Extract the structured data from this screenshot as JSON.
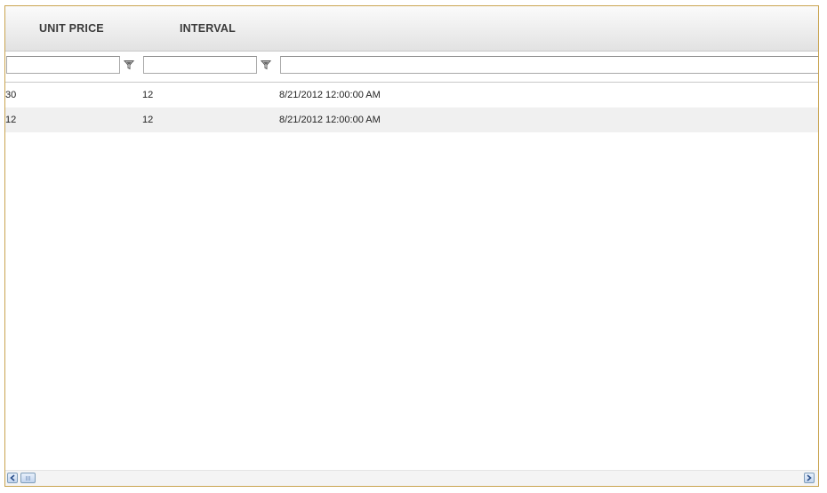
{
  "grid": {
    "columns": [
      {
        "label": "UNIT PRICE"
      },
      {
        "label": "INTERVAL"
      },
      {
        "label": ""
      }
    ],
    "filters": [
      {
        "value": "",
        "icon": "filter-icon"
      },
      {
        "value": "",
        "icon": "filter-icon"
      },
      {
        "value": ""
      }
    ],
    "rows": [
      {
        "unit_price": "30",
        "interval": "12",
        "date": "8/21/2012 12:00:00 AM"
      },
      {
        "unit_price": "12",
        "interval": "12",
        "date": "8/21/2012 12:00:00 AM"
      }
    ]
  },
  "scrollbar": {
    "left_icon": "chevron-left-icon",
    "right_icon": "chevron-right-icon"
  },
  "colors": {
    "border": "#c9a450",
    "alt_row": "#f0f0f0",
    "scroll_button": "#c3d5ee"
  }
}
